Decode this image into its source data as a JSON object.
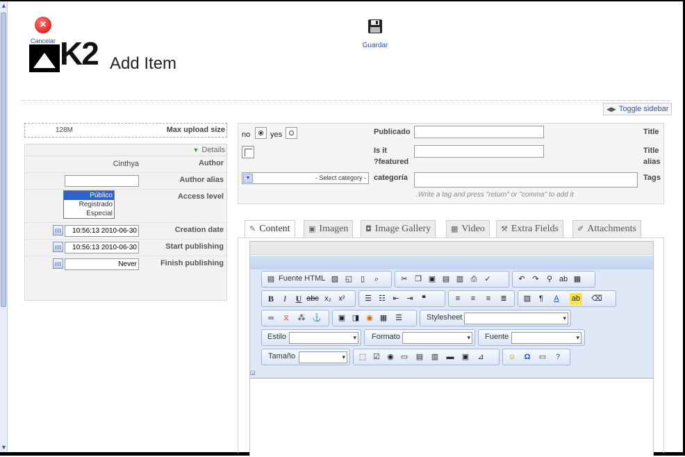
{
  "toolbar": {
    "cancel_label": "Cancelar",
    "save_label": "Guardar",
    "title": "Add Item",
    "logo_text": "K2"
  },
  "toggle_sidebar": "Toggle sidebar",
  "sidebar": {
    "max_upload_value": "128M",
    "max_upload_label": "Max upload size",
    "details_label": "Details",
    "author_value": "Cinthya",
    "author_label": "Author",
    "author_alias_label": "Author alias",
    "access_level_label": "Access level",
    "access_options": [
      "Público",
      "Registrado",
      "Especial"
    ],
    "creation_date_label": "Creation date",
    "creation_date_value": "10:56:13 2010-06-30",
    "start_publishing_label": "Start publishing",
    "start_publishing_value": "10:56:13 2010-06-30",
    "finish_publishing_label": "Finish publishing",
    "finish_publishing_value": "Never"
  },
  "form": {
    "no_label": "no",
    "yes_label": "yes",
    "published_label": "Publicado",
    "title_label": "Title",
    "featured_label_1": "Is it",
    "featured_label_2": "?featured",
    "title_alias_label_1": "Title",
    "title_alias_label_2": "alias",
    "category_select": "- Select category -",
    "category_label": "categoría",
    "tags_label": "Tags",
    "tag_hint": ".Write a tag and press \"return\" or \"comma\" to add it"
  },
  "tabs": [
    {
      "label": "Content",
      "icon": "edit-icon"
    },
    {
      "label": "Imagen",
      "icon": "image-icon"
    },
    {
      "label": "Image Gallery",
      "icon": "camera-icon"
    },
    {
      "label": "Video",
      "icon": "film-icon"
    },
    {
      "label": "Extra Fields",
      "icon": "tools-icon"
    },
    {
      "label": "Attachments",
      "icon": "paperclip-icon"
    }
  ],
  "editor": {
    "html_source_label": "Fuente HTML",
    "stylesheet_label": "Stylesheet",
    "style_label": "Estilo",
    "format_label": "Formato",
    "font_label": "Fuente",
    "size_label": "Tamaño"
  }
}
